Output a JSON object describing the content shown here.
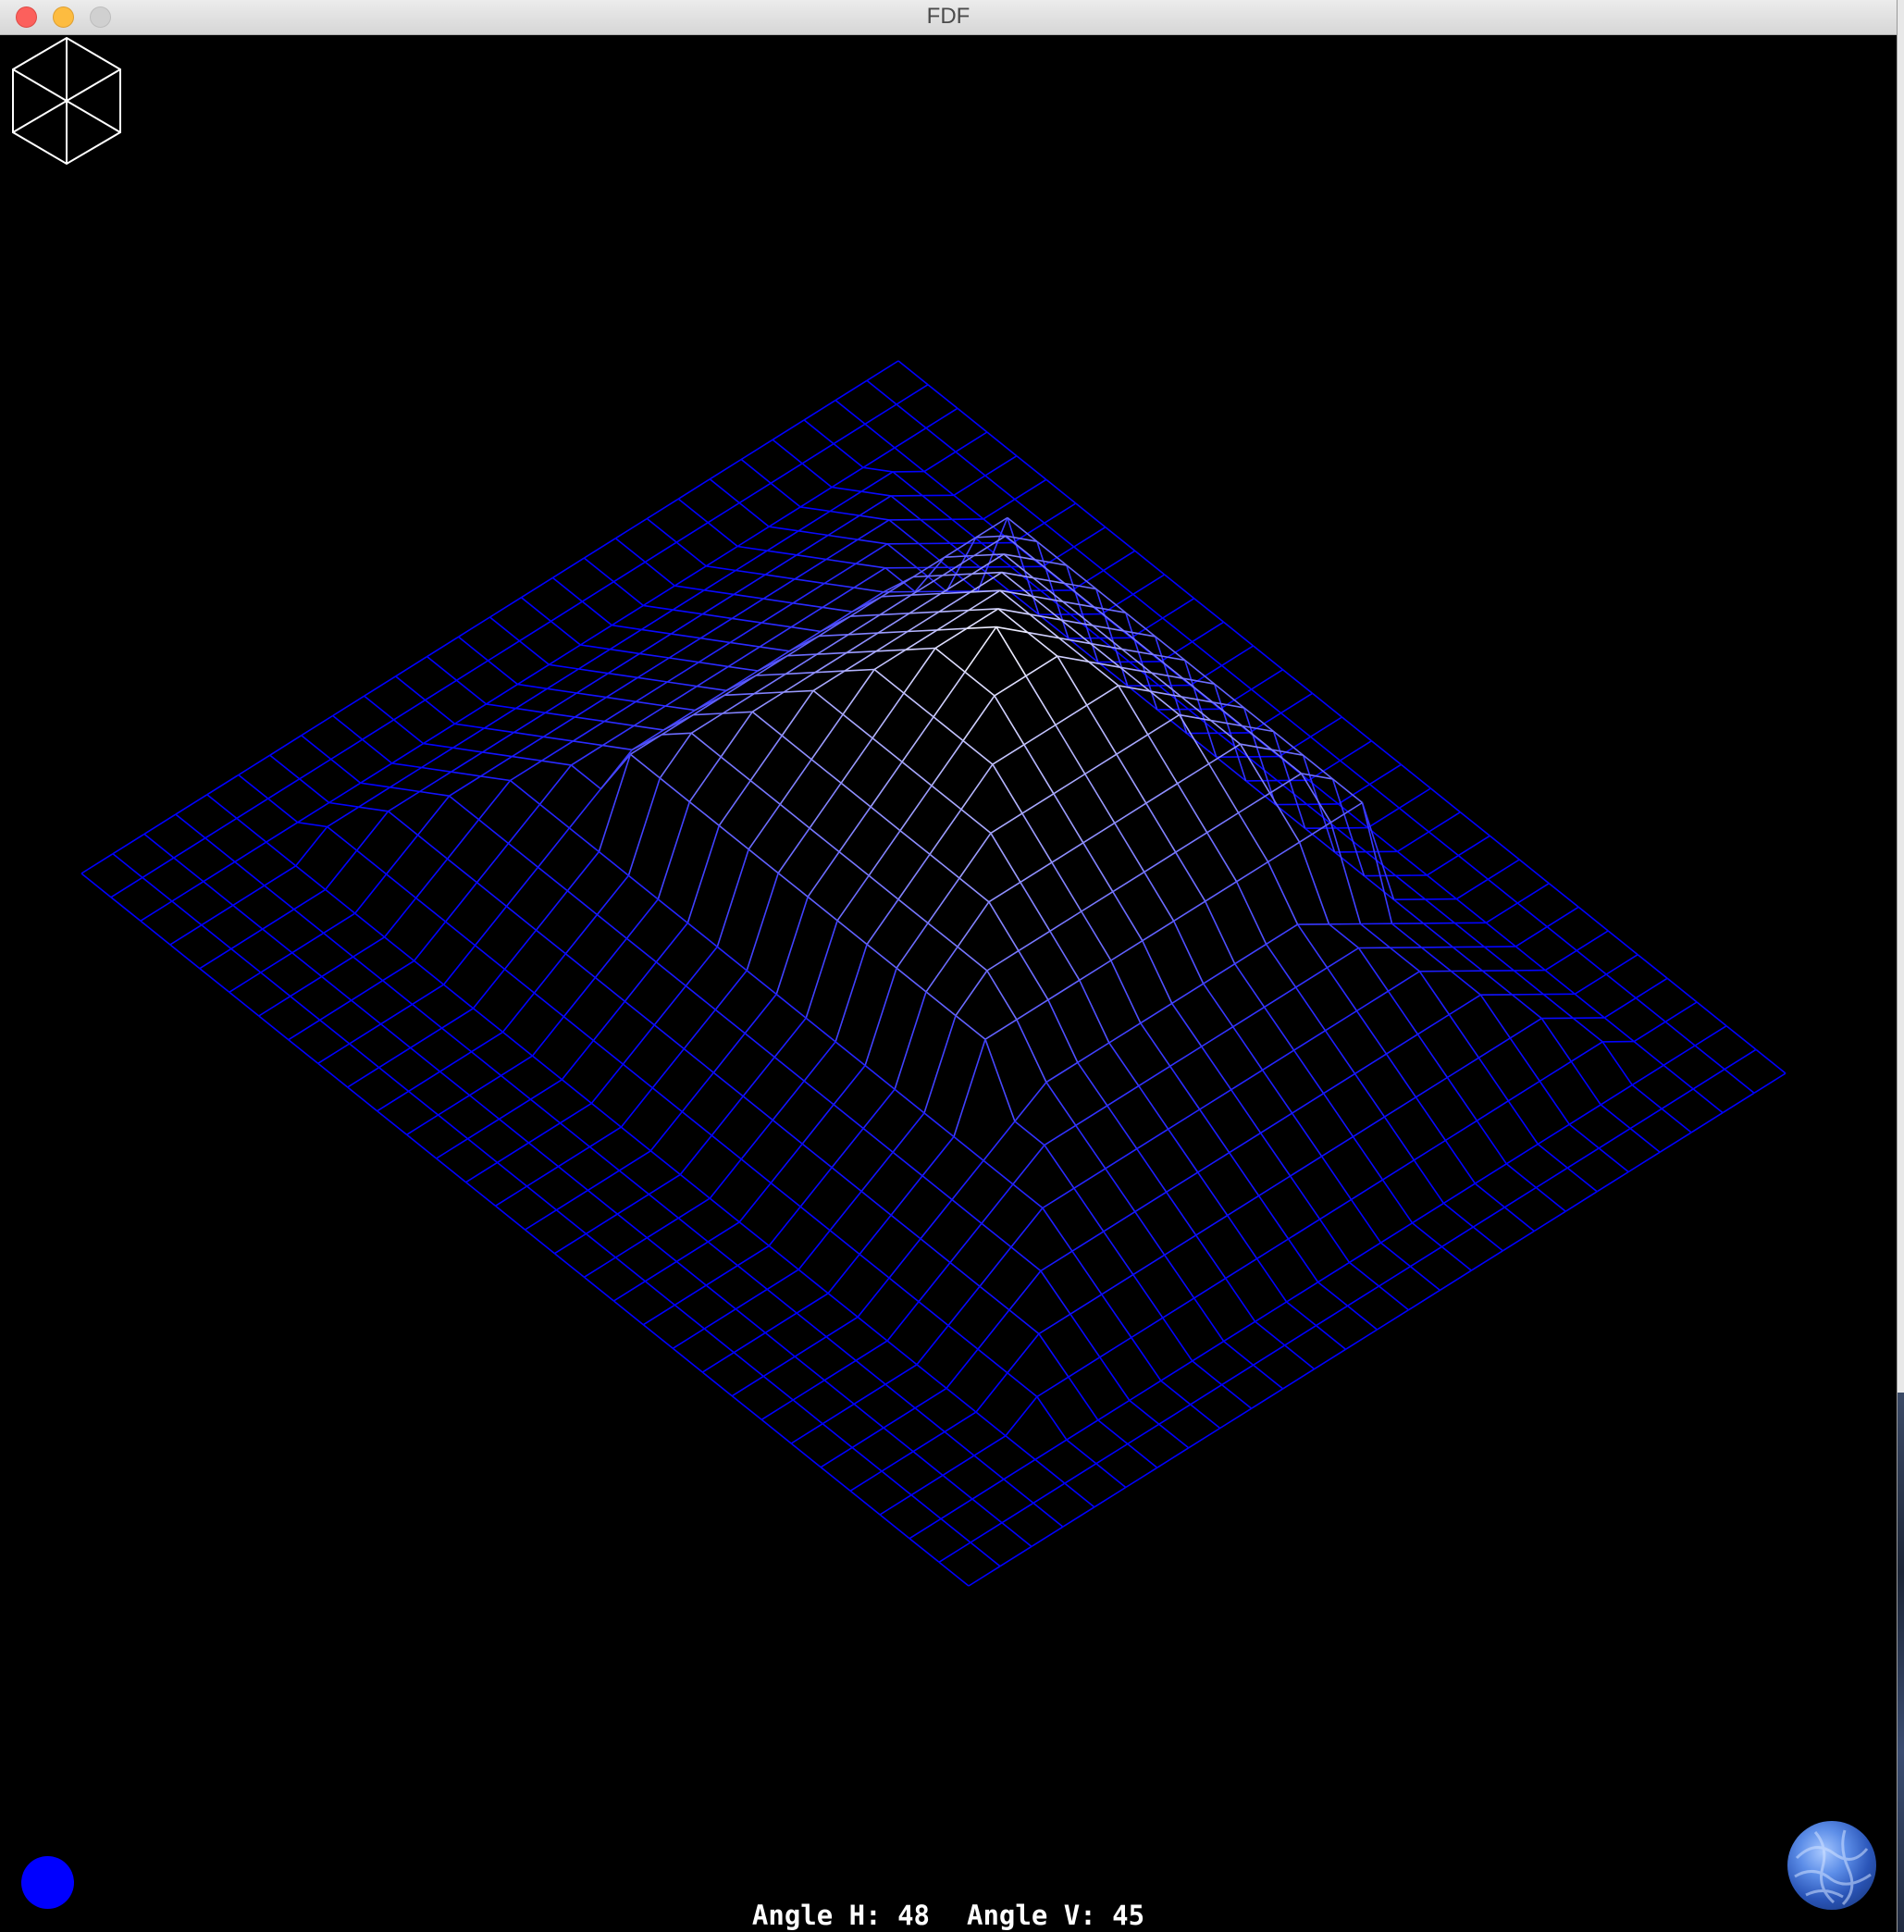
{
  "window": {
    "title": "FDF",
    "buttons": [
      "close",
      "minimize",
      "maximize"
    ]
  },
  "viewport": {
    "background_color": "#000000",
    "wireframe": {
      "type": "isometric height map",
      "low_color": "#0000ff",
      "high_color": "#ffffff",
      "grid_columns": 30,
      "grid_rows": 26
    }
  },
  "widgets": {
    "view_cube_icon": "cube-wireframe-icon",
    "color_swatch": {
      "icon": "color-dot-icon",
      "color": "#0000ff"
    },
    "globe_icon": "globe-icon"
  },
  "status": {
    "angle_h_label": "Angle H:",
    "angle_h_value": "48",
    "angle_v_label": "Angle V:",
    "angle_v_value": "45"
  }
}
